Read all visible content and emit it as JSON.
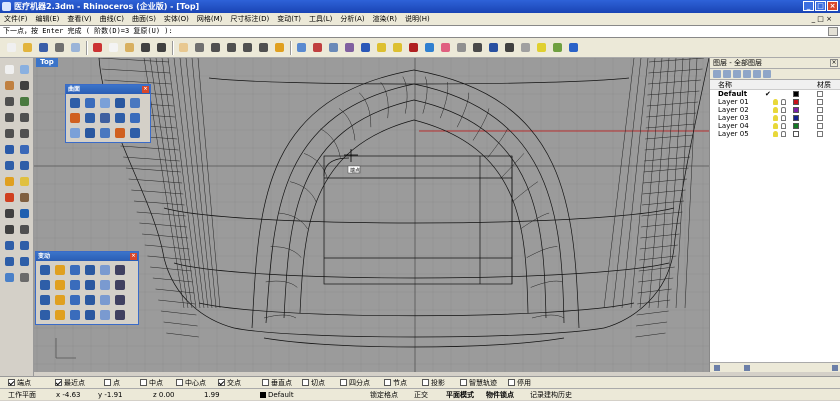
{
  "window": {
    "title": "医疗机器2.3dm - Rhinoceros (企业版) - [Top]"
  },
  "menu": {
    "items": [
      "文件(F)",
      "编辑(E)",
      "查看(V)",
      "曲线(C)",
      "曲面(S)",
      "实体(O)",
      "网格(M)",
      "尺寸标注(D)",
      "变动(T)",
      "工具(L)",
      "分析(A)",
      "渲染(R)",
      "说明(H)"
    ]
  },
  "command": {
    "prompt": "下一点，按 Enter 完成 ( 阶数(D)=3  复原(U) ):"
  },
  "viewport": {
    "label": "Top",
    "cursor_label": "端点"
  },
  "panels": {
    "surface": {
      "title": "曲面",
      "icons": [
        "surface-3-corners",
        "surface-rect",
        "surface-planar",
        "surface-edge",
        "surface-extrude",
        "surface-loft",
        "surface-revolve",
        "surface-sweep1",
        "surface-sweep2",
        "surface-network",
        "surface-patch",
        "surface-drape",
        "surface-heightfield",
        "surface-blend",
        "surface-offset"
      ]
    },
    "transform": {
      "title": "变动",
      "icons": [
        "move",
        "copy",
        "rotate",
        "scale",
        "mirror",
        "array",
        "orient",
        "align",
        "bend",
        "twist",
        "taper",
        "flow",
        "smash",
        "unroll",
        "project",
        "set-points",
        "shear",
        "stretch",
        "flow-surface",
        "cage",
        "splop",
        "maelstrom",
        "orient-surface",
        "edit-points"
      ]
    }
  },
  "layers": {
    "panel_title": "图层 - 全部图层",
    "col_name": "名称",
    "col_material": "材质",
    "rows": [
      {
        "name": "Default",
        "current": true,
        "check": "✔",
        "color": "#000000"
      },
      {
        "name": "Layer 01",
        "current": false,
        "check": "",
        "color": "#c8101a"
      },
      {
        "name": "Layer 02",
        "current": false,
        "check": "",
        "color": "#7a1fa8"
      },
      {
        "name": "Layer 03",
        "current": false,
        "check": "",
        "color": "#14208e"
      },
      {
        "name": "Layer 04",
        "current": false,
        "check": "",
        "color": "#147a24"
      },
      {
        "name": "Layer 05",
        "current": false,
        "check": "",
        "color": "#ffffff"
      }
    ]
  },
  "osnap": [
    {
      "label": "端点",
      "on": true
    },
    {
      "label": "最近点",
      "on": true
    },
    {
      "label": "点",
      "on": false
    },
    {
      "label": "中点",
      "on": false
    },
    {
      "label": "中心点",
      "on": false
    },
    {
      "label": "交点",
      "on": true
    },
    {
      "label": "垂直点",
      "on": false
    },
    {
      "label": "切点",
      "on": false
    },
    {
      "label": "四分点",
      "on": false
    },
    {
      "label": "节点",
      "on": false
    },
    {
      "label": "投影",
      "on": false
    },
    {
      "label": "智慧轨迹",
      "on": false
    },
    {
      "label": "停用",
      "on": false
    }
  ],
  "status": {
    "cplane": "工作平面",
    "x": "x -4.63",
    "y": "y -1.91",
    "z": "z 0.00",
    "dist": "1.99",
    "layer": "Default",
    "lock_grid": "锁定格点",
    "ortho": "正交",
    "planar": "平面模式",
    "osnap": "物件锁点",
    "history": "记录建构历史"
  },
  "colors": {
    "viewport_bg": "#9b9b9b",
    "grid_line": "#8d8d8d",
    "axis": "#555555",
    "x_axis_red": "#b83030",
    "model_line": "#111111",
    "title_blue": "#2a57c4"
  }
}
